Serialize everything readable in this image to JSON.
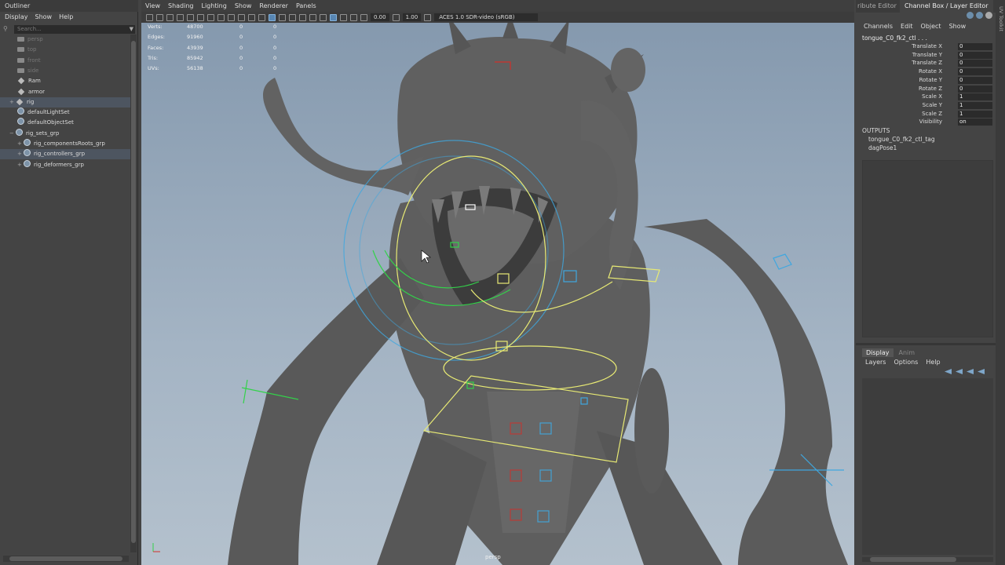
{
  "outliner": {
    "title": "Outliner",
    "menu": [
      "Display",
      "Show",
      "Help"
    ],
    "search_placeholder": "Search...",
    "items": [
      {
        "label": "persp",
        "dim": true,
        "icon": "camera-icon"
      },
      {
        "label": "top",
        "dim": true,
        "icon": "camera-icon"
      },
      {
        "label": "front",
        "dim": true,
        "icon": "camera-icon"
      },
      {
        "label": "side",
        "dim": true,
        "icon": "camera-icon"
      },
      {
        "label": "Ram",
        "dim": false,
        "icon": "transform-icon"
      },
      {
        "label": "armor",
        "dim": false,
        "icon": "transform-icon"
      },
      {
        "label": "rig",
        "dim": false,
        "icon": "transform-icon",
        "selected": true,
        "expand": "+"
      },
      {
        "label": "defaultLightSet",
        "dim": false,
        "icon": "set-icon"
      },
      {
        "label": "defaultObjectSet",
        "dim": false,
        "icon": "set-icon"
      },
      {
        "label": "rig_sets_grp",
        "dim": false,
        "icon": "set-icon",
        "expand": "−"
      },
      {
        "label": "rig_componentsRoots_grp",
        "dim": false,
        "icon": "set-icon",
        "expand": "+"
      },
      {
        "label": "rig_controllers_grp",
        "dim": false,
        "icon": "set-icon",
        "expand": "+",
        "selected": true
      },
      {
        "label": "rig_deformers_grp",
        "dim": false,
        "icon": "set-icon",
        "expand": "+"
      }
    ]
  },
  "viewport": {
    "menu": [
      "View",
      "Shading",
      "Lighting",
      "Show",
      "Renderer",
      "Panels"
    ],
    "toolbar": {
      "exposure": "0.00",
      "gamma": "1.00",
      "color_space": "ACES 1.0 SDR-video (sRGB)"
    },
    "hud": [
      {
        "label": "Verts:",
        "v1": "48700",
        "v2": "0",
        "v3": "0"
      },
      {
        "label": "Edges:",
        "v1": "91960",
        "v2": "0",
        "v3": "0"
      },
      {
        "label": "Faces:",
        "v1": "43939",
        "v2": "0",
        "v3": "0"
      },
      {
        "label": "Tris:",
        "v1": "85942",
        "v2": "0",
        "v3": "0"
      },
      {
        "label": "UVs:",
        "v1": "56138",
        "v2": "0",
        "v3": "0"
      }
    ],
    "camera_label": "persp",
    "colors": {
      "sky_top": "#8599ae",
      "sky_bottom": "#b4c1cd",
      "model": "#5f5f5f",
      "ctrl_yellow": "#e8ea74",
      "ctrl_green": "#33d24a",
      "ctrl_blue": "#3fa7e0",
      "ctrl_red": "#d0302a"
    }
  },
  "right_panel": {
    "tab_inactive": "ribute Editor",
    "tab_active": "Channel Box / Layer Editor",
    "channel_menu": [
      "Channels",
      "Edit",
      "Object",
      "Show"
    ],
    "object_name": "tongue_C0_fk2_ctl . . .",
    "attributes": [
      {
        "label": "Translate X",
        "value": "0"
      },
      {
        "label": "Translate Y",
        "value": "0"
      },
      {
        "label": "Translate Z",
        "value": "0"
      },
      {
        "label": "Rotate X",
        "value": "0"
      },
      {
        "label": "Rotate Y",
        "value": "0"
      },
      {
        "label": "Rotate Z",
        "value": "0"
      },
      {
        "label": "Scale X",
        "value": "1"
      },
      {
        "label": "Scale Y",
        "value": "1"
      },
      {
        "label": "Scale Z",
        "value": "1"
      },
      {
        "label": "Visibility",
        "value": "on"
      }
    ],
    "outputs_label": "OUTPUTS",
    "outputs": [
      "tongue_C0_fk2_ctl_tag",
      "dagPose1"
    ],
    "layer_tabs": [
      "Display",
      "Anim"
    ],
    "layer_menu": [
      "Layers",
      "Options",
      "Help"
    ]
  },
  "side_strip_label": "UV Toolkit"
}
